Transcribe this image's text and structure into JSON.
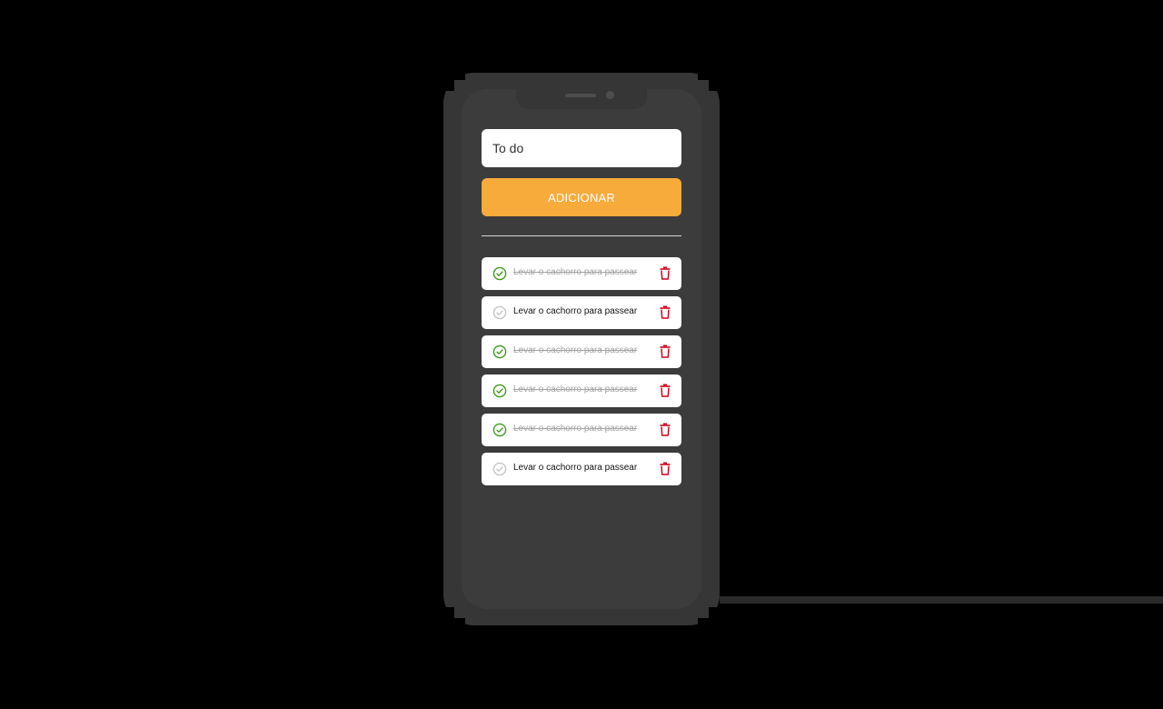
{
  "input": {
    "placeholder": "To do",
    "value": ""
  },
  "add_button": {
    "label": "ADICIONAR"
  },
  "tasks": [
    {
      "label": "Levar o cachorro para passear",
      "done": true
    },
    {
      "label": "Levar o cachorro para passear",
      "done": false
    },
    {
      "label": "Levar o cachorro para passear",
      "done": true
    },
    {
      "label": "Levar o cachorro para passear",
      "done": true
    },
    {
      "label": "Levar o cachorro para passear",
      "done": true
    },
    {
      "label": "Levar o cachorro para passear",
      "done": false
    }
  ],
  "icons": {
    "check_done": "check-circle-icon",
    "check_pending": "check-circle-outline-icon",
    "delete": "trash-icon"
  },
  "colors": {
    "accent": "#f7ab3b",
    "done_check": "#3f9a1e",
    "pending_check": "#c4c4c4",
    "delete": "#d0021b",
    "page_background": "#000000",
    "phone_body": "#363636",
    "screen": "#3c3c3c"
  }
}
